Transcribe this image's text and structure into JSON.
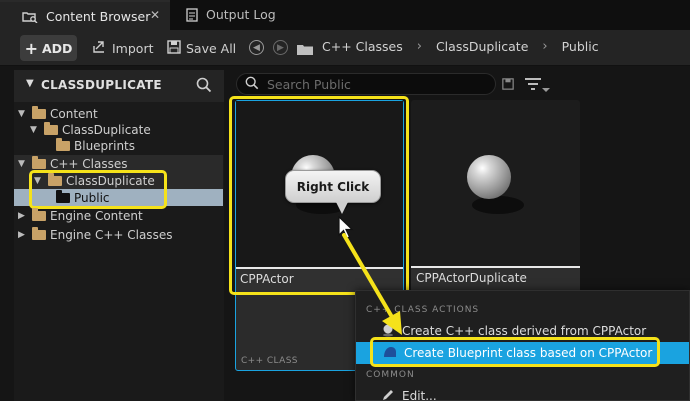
{
  "tabs": [
    {
      "label": "Content Browser",
      "close": "✕"
    },
    {
      "label": "Output Log"
    }
  ],
  "toolbar": {
    "add_label": "ADD",
    "add_plus": "+",
    "import_label": "Import",
    "save_all_label": "Save All",
    "breadcrumbs": [
      "C++ Classes",
      "ClassDuplicate",
      "Public"
    ]
  },
  "sources": {
    "header": "CLASSDUPLICATE",
    "tree": [
      {
        "label": "Content"
      },
      {
        "label": "ClassDuplicate"
      },
      {
        "label": "Blueprints"
      },
      {
        "label": "C++ Classes"
      },
      {
        "label": "ClassDuplicate"
      },
      {
        "label": "Public"
      },
      {
        "label": "Engine Content"
      },
      {
        "label": "Engine C++ Classes"
      }
    ]
  },
  "search": {
    "placeholder": "Search Public"
  },
  "assets": [
    {
      "name": "CPPActor",
      "type": "C++ CLASS"
    },
    {
      "name": "CPPActorDuplicate"
    }
  ],
  "callout": {
    "text": "Right Click"
  },
  "context_menu": {
    "section_cpp": "C++ CLASS ACTIONS",
    "items": [
      {
        "label": "Create C++ class derived from CPPActor"
      },
      {
        "label": "Create Blueprint class based on CPPActor"
      }
    ],
    "section_common": "COMMON",
    "edit_label": "Edit..."
  },
  "colors": {
    "highlight": "#f5e21a",
    "selection": "#1aa3e0",
    "selected_row": "#9fb1c0",
    "folder": "#c8a267"
  }
}
